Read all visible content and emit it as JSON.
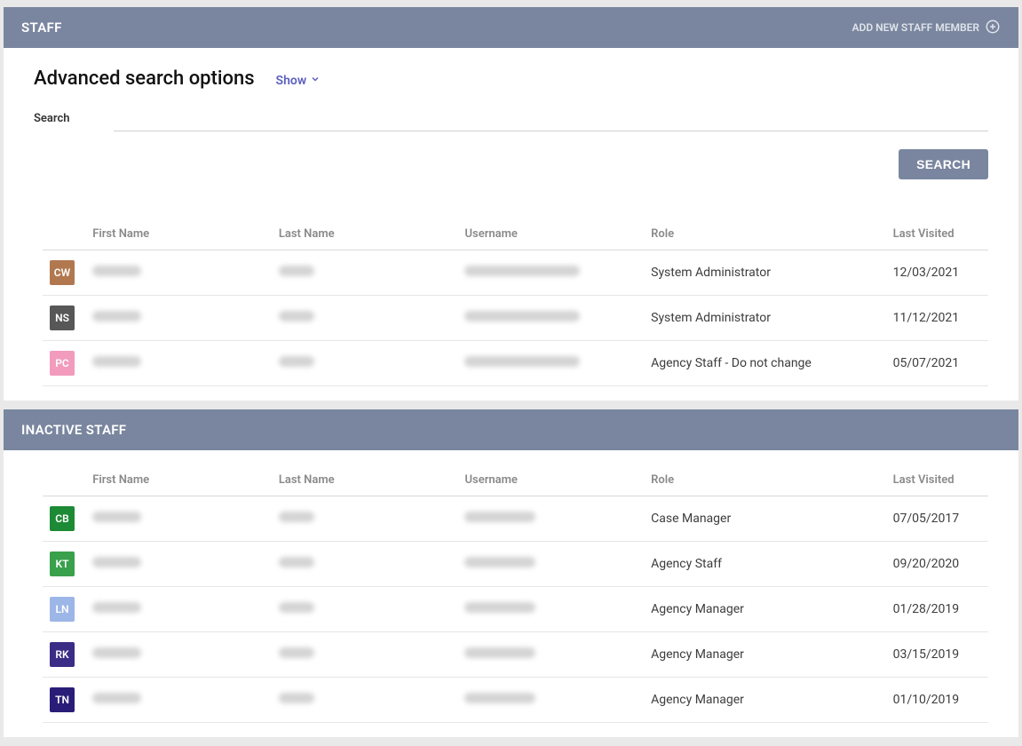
{
  "staff_panel": {
    "title": "STAFF",
    "add_label": "ADD NEW STAFF MEMBER"
  },
  "advanced": {
    "title": "Advanced search options",
    "show_label": "Show"
  },
  "search": {
    "label": "Search",
    "button": "SEARCH"
  },
  "columns": {
    "first": "First Name",
    "last": "Last Name",
    "user": "Username",
    "role": "Role",
    "visited": "Last Visited"
  },
  "staff_rows": [
    {
      "initials": "CW",
      "color": "#b1784f",
      "role": "System Administrator",
      "visited": "12/03/2021"
    },
    {
      "initials": "NS",
      "color": "#575757",
      "role": "System Administrator",
      "visited": "11/12/2021"
    },
    {
      "initials": "PC",
      "color": "#f29bbd",
      "role": "Agency Staff - Do not change",
      "visited": "05/07/2021"
    }
  ],
  "inactive_panel": {
    "title": "INACTIVE STAFF"
  },
  "inactive_rows": [
    {
      "initials": "CB",
      "color": "#1d8a35",
      "role": "Case Manager",
      "visited": "07/05/2017"
    },
    {
      "initials": "KT",
      "color": "#39a04b",
      "role": "Agency Staff",
      "visited": "09/20/2020"
    },
    {
      "initials": "LN",
      "color": "#9db6e8",
      "role": "Agency Manager",
      "visited": "01/28/2019"
    },
    {
      "initials": "RK",
      "color": "#3b2c85",
      "role": "Agency Manager",
      "visited": "03/15/2019"
    },
    {
      "initials": "TN",
      "color": "#2a1d78",
      "role": "Agency Manager",
      "visited": "01/10/2019"
    }
  ]
}
